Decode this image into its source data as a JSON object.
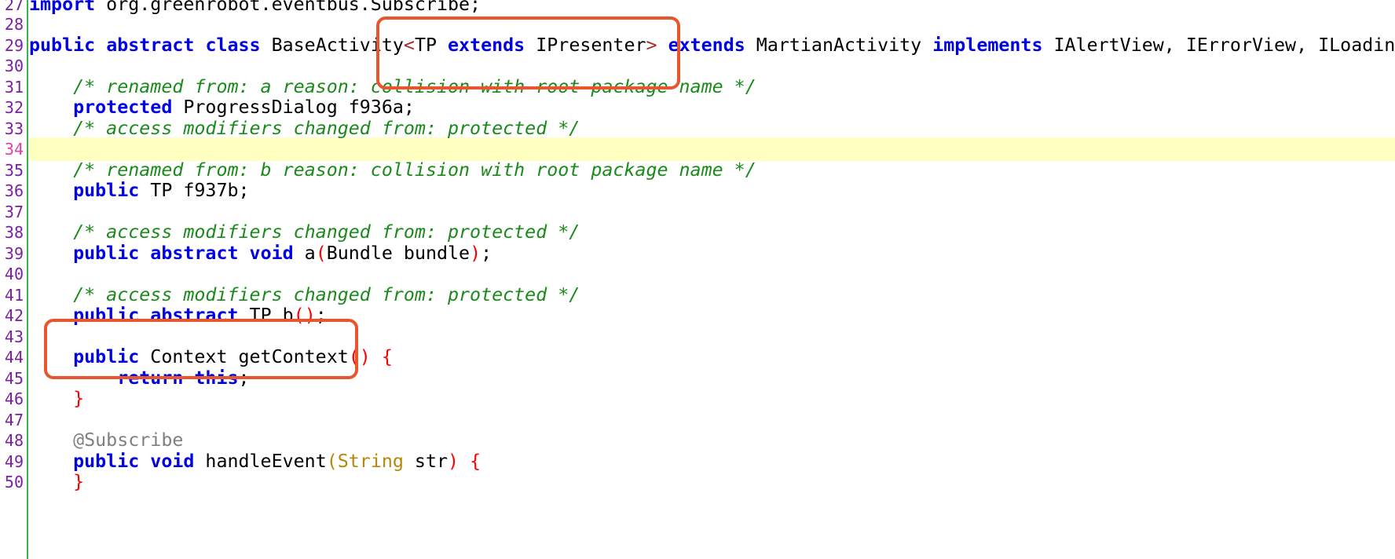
{
  "gutter": {
    "line_numbers": [
      "27",
      "28",
      "29",
      "30",
      "31",
      "32",
      "33",
      "34",
      "35",
      "36",
      "37",
      "38",
      "39",
      "40",
      "41",
      "42",
      "43",
      "44",
      "45",
      "46",
      "47",
      "48",
      "49",
      "50"
    ],
    "current_line": "34"
  },
  "code": {
    "l27": {
      "kw": "import",
      "rest": " org.greenrobot.eventbus.Subscribe;"
    },
    "l29": {
      "kw1": "public",
      "kw2": "abstract",
      "kw3": "class",
      "name": " BaseActivity",
      "lt": "<",
      "tp": "TP ",
      "kw4": "extends",
      "iface": " IPresenter",
      "gt": ">",
      "kw5": "extends",
      "parent": " MartianActivity ",
      "kw6": "implements",
      "ifaces": " IAlertView, IErrorView, ILoading"
    },
    "l31": {
      "comment": "/* renamed from: a reason: collision with root package name */"
    },
    "l32": {
      "kw": "protected",
      "rest": " ProgressDialog f936a;"
    },
    "l33": {
      "comment": "/* access modifiers changed from: protected */"
    },
    "l35": {
      "comment": "/* renamed from: b reason: collision with root package name */"
    },
    "l36": {
      "kw": "public",
      "rest": " TP f937b;"
    },
    "l38": {
      "comment": "/* access modifiers changed from: protected */"
    },
    "l39": {
      "kw1": "public",
      "kw2": "abstract",
      "kw3": "void",
      "name": " a",
      "po": "(",
      "args": "Bundle bundle",
      "pc": ")",
      "end": ";"
    },
    "l41": {
      "comment": "/* access modifiers changed from: protected */"
    },
    "l42": {
      "kw1": "public",
      "kw2": "abstract",
      "name": " TP b",
      "po": "(",
      "pc": ")",
      "end": ";"
    },
    "l44": {
      "kw": "public",
      "name": " Context getContext",
      "po": "(",
      "pc": ")",
      "brace": "{"
    },
    "l45": {
      "kw1": "return",
      "kw2": "this",
      "end": ";"
    },
    "l46": {
      "brace": "}"
    },
    "l48": {
      "annotation": "@Subscribe"
    },
    "l49": {
      "kw1": "public",
      "kw2": "void",
      "name": " handleEvent",
      "po": "(",
      "type": "String",
      "arg": " str",
      "pc": ")",
      "brace": "{"
    },
    "l50": {
      "brace": "}"
    }
  },
  "colors": {
    "keyword": "#0000e6",
    "comment": "#1a8a1a",
    "paren": "#ff0000",
    "highlight_box": "#e8562e",
    "current_line_bg": "#ffffc0",
    "gutter_border": "#39b54a"
  }
}
